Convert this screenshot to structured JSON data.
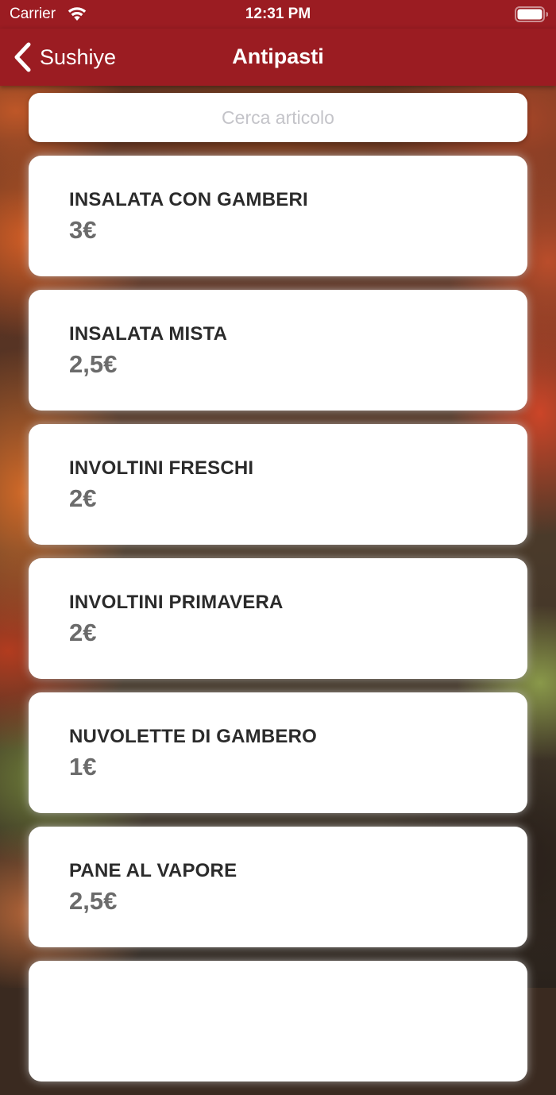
{
  "status_bar": {
    "carrier": "Carrier",
    "time": "12:31 PM",
    "wifi_icon": "wifi-icon",
    "battery_icon": "battery-icon"
  },
  "nav": {
    "back_label": "Sushiye",
    "title": "Antipasti",
    "color": "#9b1c22"
  },
  "search": {
    "placeholder": "Cerca articolo",
    "value": ""
  },
  "items": [
    {
      "name": "INSALATA CON GAMBERI",
      "price": "3€"
    },
    {
      "name": "INSALATA MISTA",
      "price": "2,5€"
    },
    {
      "name": "INVOLTINI FRESCHI",
      "price": "2€"
    },
    {
      "name": "INVOLTINI PRIMAVERA",
      "price": "2€"
    },
    {
      "name": "NUVOLETTE DI GAMBERO",
      "price": "1€"
    },
    {
      "name": "PANE AL VAPORE",
      "price": "2,5€"
    },
    {
      "name": "",
      "price": ""
    }
  ]
}
